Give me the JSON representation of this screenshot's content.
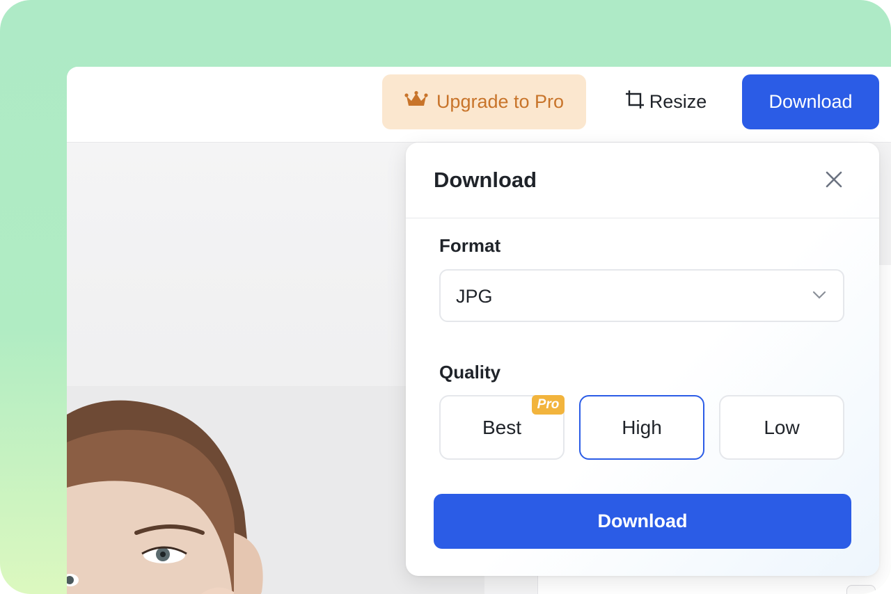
{
  "toolbar": {
    "upgrade_label": "Upgrade to Pro",
    "resize_label": "Resize",
    "download_label": "Download"
  },
  "dialog": {
    "title": "Download",
    "format_label": "Format",
    "format_value": "JPG",
    "quality_label": "Quality",
    "quality_options": [
      {
        "label": "Best",
        "badge": "Pro",
        "selected": false
      },
      {
        "label": "High",
        "selected": true
      },
      {
        "label": "Low",
        "selected": false
      }
    ],
    "download_button": "Download"
  },
  "colors": {
    "accent": "#2b5ce6",
    "pro_text": "#c8742a",
    "pro_bg": "#fbe7cf",
    "badge": "#f2b43d",
    "frame_green": "#aeeac6"
  },
  "icons": {
    "upgrade": "crown-icon",
    "resize": "crop-icon",
    "close": "close-icon",
    "dropdown": "chevron-down-icon"
  }
}
